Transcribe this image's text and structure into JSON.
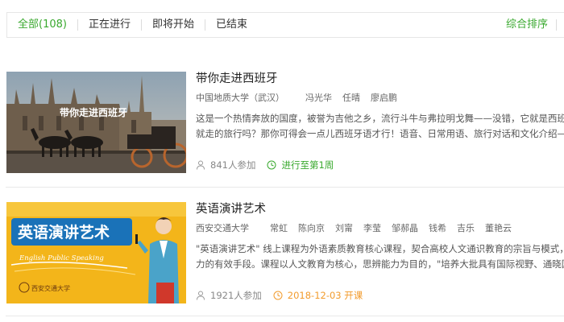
{
  "filters": {
    "tabs": [
      {
        "label": "全部(108)"
      },
      {
        "label": "正在进行"
      },
      {
        "label": "即将开始"
      },
      {
        "label": "已结束"
      }
    ],
    "sort_label": "综合排序"
  },
  "courses": [
    {
      "title": "带你走进西班牙",
      "thumb_caption": "带你走进西班牙",
      "school": "中国地质大学（武汉）",
      "teachers": [
        "冯光华",
        "任晴",
        "廖启鹏"
      ],
      "desc_lines": [
        "这是一个热情奔放的国度，被誉为吉他之乡，流行斗牛与弗拉明戈舞——没错，它就是西班牙！",
        "就走的旅行吗？那你可得会一点儿西班牙语才行！语音、日常用语、旅行对话和文化介绍——本"
      ],
      "enroll": "841人参加",
      "status": "进行至第1周",
      "status_icon": "clock-icon"
    },
    {
      "title": "英语演讲艺术",
      "thumb_caption": "英语演讲艺术",
      "thumb_subcaption": "English Public Speaking",
      "thumb_logo_text": "西安交通大学",
      "school": "西安交通大学",
      "teachers": [
        "常虹",
        "陈向京",
        "刘甯",
        "李莹",
        "邹郝晶",
        "钱希",
        "吉乐",
        "董艳云"
      ],
      "desc_lines": [
        "\"英语演讲艺术\" 线上课程为外语素质教育核心课程，契合高校人文通识教育的宗旨与模式，是提",
        "力的有效手段。课程以人文教育为核心，思辨能力为目的，\"培养大批具有国际视野、通晓国际"
      ],
      "enroll": "1921人参加",
      "status": "2018-12-03 开课",
      "status_icon": "clock-icon"
    }
  ],
  "colors": {
    "accent_green": "#39a92e",
    "upcoming_orange": "#f29b2c"
  }
}
